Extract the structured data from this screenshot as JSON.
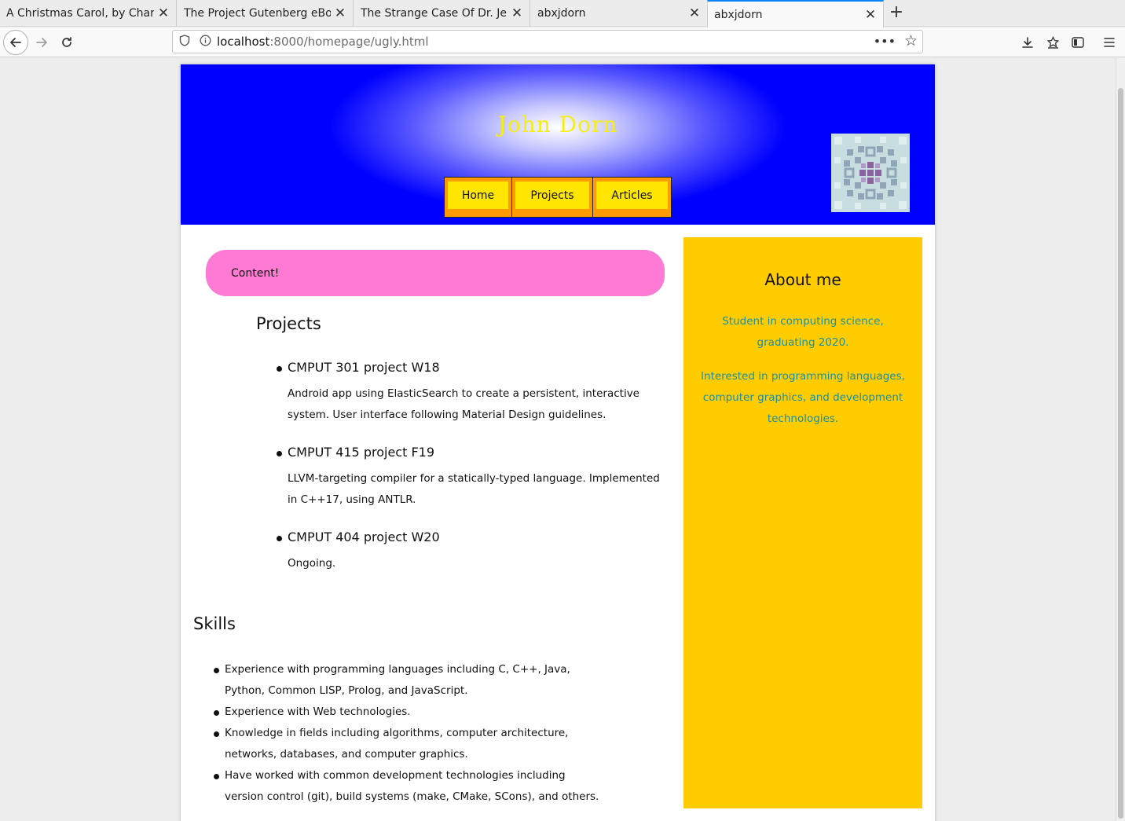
{
  "browser": {
    "tabs": [
      {
        "title": "A Christmas Carol, by Charles Dickens"
      },
      {
        "title": "The Project Gutenberg eBook of"
      },
      {
        "title": "The Strange Case Of Dr. Jekyll"
      },
      {
        "title": "abxjdorn"
      },
      {
        "title": "abxjdorn"
      }
    ],
    "url_host": "localhost",
    "url_path": ":8000/homepage/ugly.html"
  },
  "site": {
    "title": "John Dorn",
    "nav": [
      "Home",
      "Projects",
      "Articles"
    ]
  },
  "main": {
    "banner": "Content!",
    "projects_heading": "Projects",
    "projects": [
      {
        "name": "CMPUT 301 project W18",
        "description": "Android app using ElasticSearch to create a persistent, interactive system. User interface following Material Design guidelines."
      },
      {
        "name": "CMPUT 415 project F19",
        "description": "LLVM-targeting compiler for a statically-typed language. Implemented in C++17, using ANTLR."
      },
      {
        "name": "CMPUT 404 project W20",
        "description": "Ongoing."
      }
    ],
    "skills_heading": "Skills",
    "skills": [
      "Experience with programming languages including C, C++, Java, Python, Common LISP, Prolog, and JavaScript.",
      "Experience with Web technologies.",
      "Knowledge in fields including algorithms, computer architecture, networks, databases, and computer graphics.",
      "Have worked with common development technologies including version control (git), build systems (make, CMake, SCons), and others."
    ]
  },
  "sidebar": {
    "heading": "About me",
    "paragraphs": [
      "Student in computing science, graduating 2020.",
      "Interested in programming languages, computer graphics, and development technologies."
    ]
  },
  "colors": {
    "header_blue": "#0000ff",
    "title_yellow": "#f5ee10",
    "nav_orange": "#ff9a00",
    "nav_yellow": "#ffe600",
    "banner_pink": "#ff7ad4",
    "sidebar_gold": "#ffcc00",
    "sidebar_text": "#1a8fa3"
  }
}
